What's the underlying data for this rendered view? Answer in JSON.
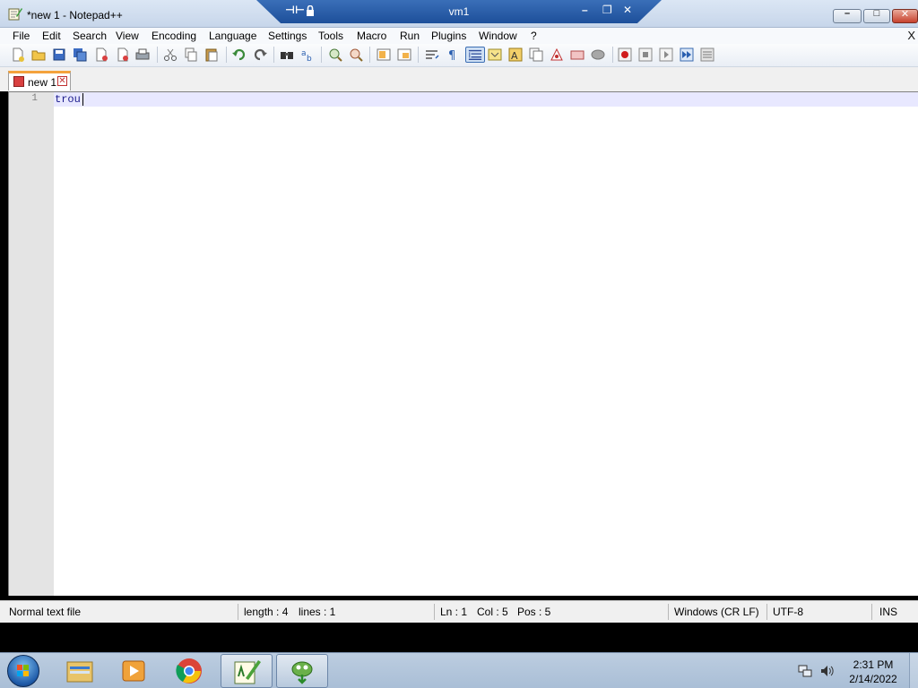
{
  "window": {
    "title": "*new 1 - Notepad++",
    "controls": {
      "minimize": "–",
      "maximize": "□",
      "close": "✕"
    },
    "outer_close": "X"
  },
  "rdp_bar": {
    "title": "vm1",
    "pin_icon": "pin-icon",
    "lock_icon": "lock-icon",
    "controls": {
      "minimize": "–",
      "restore": "❐",
      "close": "✕"
    }
  },
  "menu": [
    "File",
    "Edit",
    "Search",
    "View",
    "Encoding",
    "Language",
    "Settings",
    "Tools",
    "Macro",
    "Run",
    "Plugins",
    "Window",
    "?"
  ],
  "toolbar_icons": [
    "new-file-icon",
    "open-file-icon",
    "save-icon",
    "save-all-icon",
    "close-icon",
    "close-all-icon",
    "print-icon",
    "cut-icon",
    "copy-icon",
    "paste-icon",
    "undo-icon",
    "redo-icon",
    "find-icon",
    "replace-icon",
    "zoom-in-icon",
    "zoom-out-icon",
    "sync-vertical-icon",
    "sync-horizontal-icon",
    "word-wrap-icon",
    "show-all-chars-icon",
    "indent-guide-icon",
    "language-icon",
    "document-map-icon",
    "function-list-icon",
    "folder-workspace-icon",
    "monitoring-icon",
    "bubble-icon",
    "record-macro-icon",
    "stop-macro-icon",
    "play-macro-icon",
    "run-macro-multiple-icon",
    "save-macro-icon"
  ],
  "tab": {
    "label": "new 1",
    "close": "✕"
  },
  "editor": {
    "line_number": "1",
    "text": "trou"
  },
  "status": {
    "file_type": "Normal text file",
    "length": "length : 4",
    "lines": "lines : 1",
    "ln": "Ln : 1",
    "col": "Col : 5",
    "pos": "Pos : 5",
    "eol": "Windows (CR LF)",
    "encoding": "UTF-8",
    "mode": "INS"
  },
  "taskbar": {
    "apps": [
      "windows-explorer-icon",
      "media-player-icon",
      "chrome-icon",
      "notepad-plus-plus-icon",
      "notepad-plus-plus-updater-icon"
    ],
    "clock_time": "2:31 PM",
    "clock_date": "2/14/2022"
  },
  "colors": {
    "editor_text": "#1a1a8c",
    "current_line": "#e8e8ff",
    "taskbar": "#bccde0",
    "rdp_bar": "#2a5fab"
  }
}
